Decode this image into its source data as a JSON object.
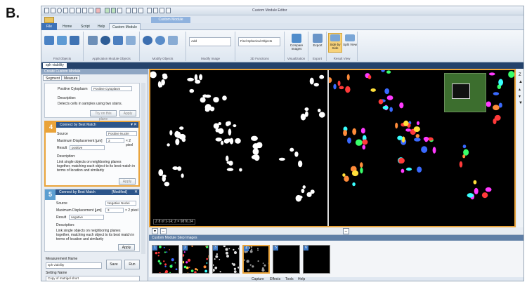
{
  "figure_label": "B.",
  "window_title": "Custom Module Editor",
  "context_tab": "Custom Module",
  "tabs": [
    "File",
    "Home",
    "Script",
    "Help",
    "Custom Module"
  ],
  "ribbon": {
    "groups": [
      "Find Objects",
      "Application Module Objects",
      "Modify Objects",
      "Modify Image",
      "3D Functions",
      "Visualization",
      "Export",
      "Result View"
    ],
    "add_field": "Add",
    "spherical_field": "Find Spherical Objects",
    "compare_label": "Compare Images",
    "export_label": "Export",
    "side_by_side_label": "Side by Side",
    "split_view_label": "Split View"
  },
  "document_tab": "sph viability",
  "left_panel": {
    "title": "Create Custom Module",
    "tabs": [
      "Segment",
      "Measure"
    ],
    "top_card": {
      "field_label": "Positive Cytoplasm",
      "field_value": "Positive Cytoplasm",
      "description_label": "Description:",
      "description": "Detects cells in samples using two stains.",
      "buttons": [
        "Try on this plane",
        "Apply"
      ]
    },
    "step4": {
      "number": "4",
      "title": "Connect by Best Match",
      "source_label": "Source",
      "source_value": "Positive Nuclei",
      "disp_label": "Maximum Displacement [µm]",
      "disp_value": "3",
      "disp_suffix": "× 2 pixel",
      "result_label": "Result",
      "result_value": "positive",
      "description_label": "Description:",
      "description": "Link single objects on neighboring planes together, matching each object to its best match in terms of location and similarity",
      "apply": "Apply",
      "accent": "#e9a33a"
    },
    "step5": {
      "number": "5",
      "title": "Connect by Best Match",
      "modified": "[Modified]",
      "source_label": "Source",
      "source_value": "Negative Nuclei",
      "disp_label": "Maximum Displacement [µm]",
      "disp_value": "3",
      "disp_suffix": "× 2 pixel",
      "result_label": "Result",
      "result_value": "negative",
      "description_label": "Description:",
      "description": "Link single objects on neighboring planes together, matching each object to its best match in terms of location and similarity",
      "apply": "Apply",
      "accent": "#5d9fd1"
    },
    "measurement_name_label": "Measurement Name",
    "measurement_name_value": "sph viability",
    "save": "Save",
    "run": "Run",
    "setting_name_label": "Setting Name",
    "setting_name_value": "Copy of matrigel short"
  },
  "image_area": {
    "coord_readout": "Z 8 of 1-14; Z = 9876.34"
  },
  "thumbnails": {
    "title": "Custom Module Step Images",
    "numbers": [
      "1",
      "2",
      "3",
      "4",
      "5",
      "6"
    ]
  },
  "status_bar": [
    "Capture",
    "Effects",
    "Tools",
    "Help"
  ]
}
